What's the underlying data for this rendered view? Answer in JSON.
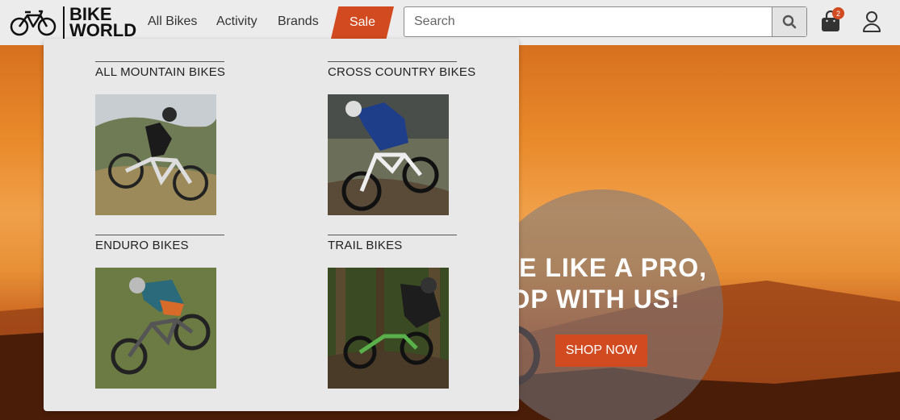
{
  "header": {
    "logo_line1": "BIKE",
    "logo_line2": "WORLD",
    "nav": [
      "All Bikes",
      "Activity",
      "Brands"
    ],
    "sale_label": "Sale",
    "search_placeholder": "Search",
    "cart_count": "2"
  },
  "mega_menu": {
    "categories": [
      {
        "title": "ALL MOUNTAIN BIKES"
      },
      {
        "title": "CROSS COUNTRY BIKES"
      },
      {
        "title": "ENDURO BIKES"
      },
      {
        "title": "TRAIL BIKES"
      }
    ]
  },
  "hero": {
    "line1": "RIDE LIKE A PRO,",
    "line2": "SHOP WITH US!",
    "cta": "SHOP NOW"
  },
  "colors": {
    "accent": "#d14a20",
    "header_bg": "#ececec",
    "menu_bg": "#e8e8e8"
  }
}
